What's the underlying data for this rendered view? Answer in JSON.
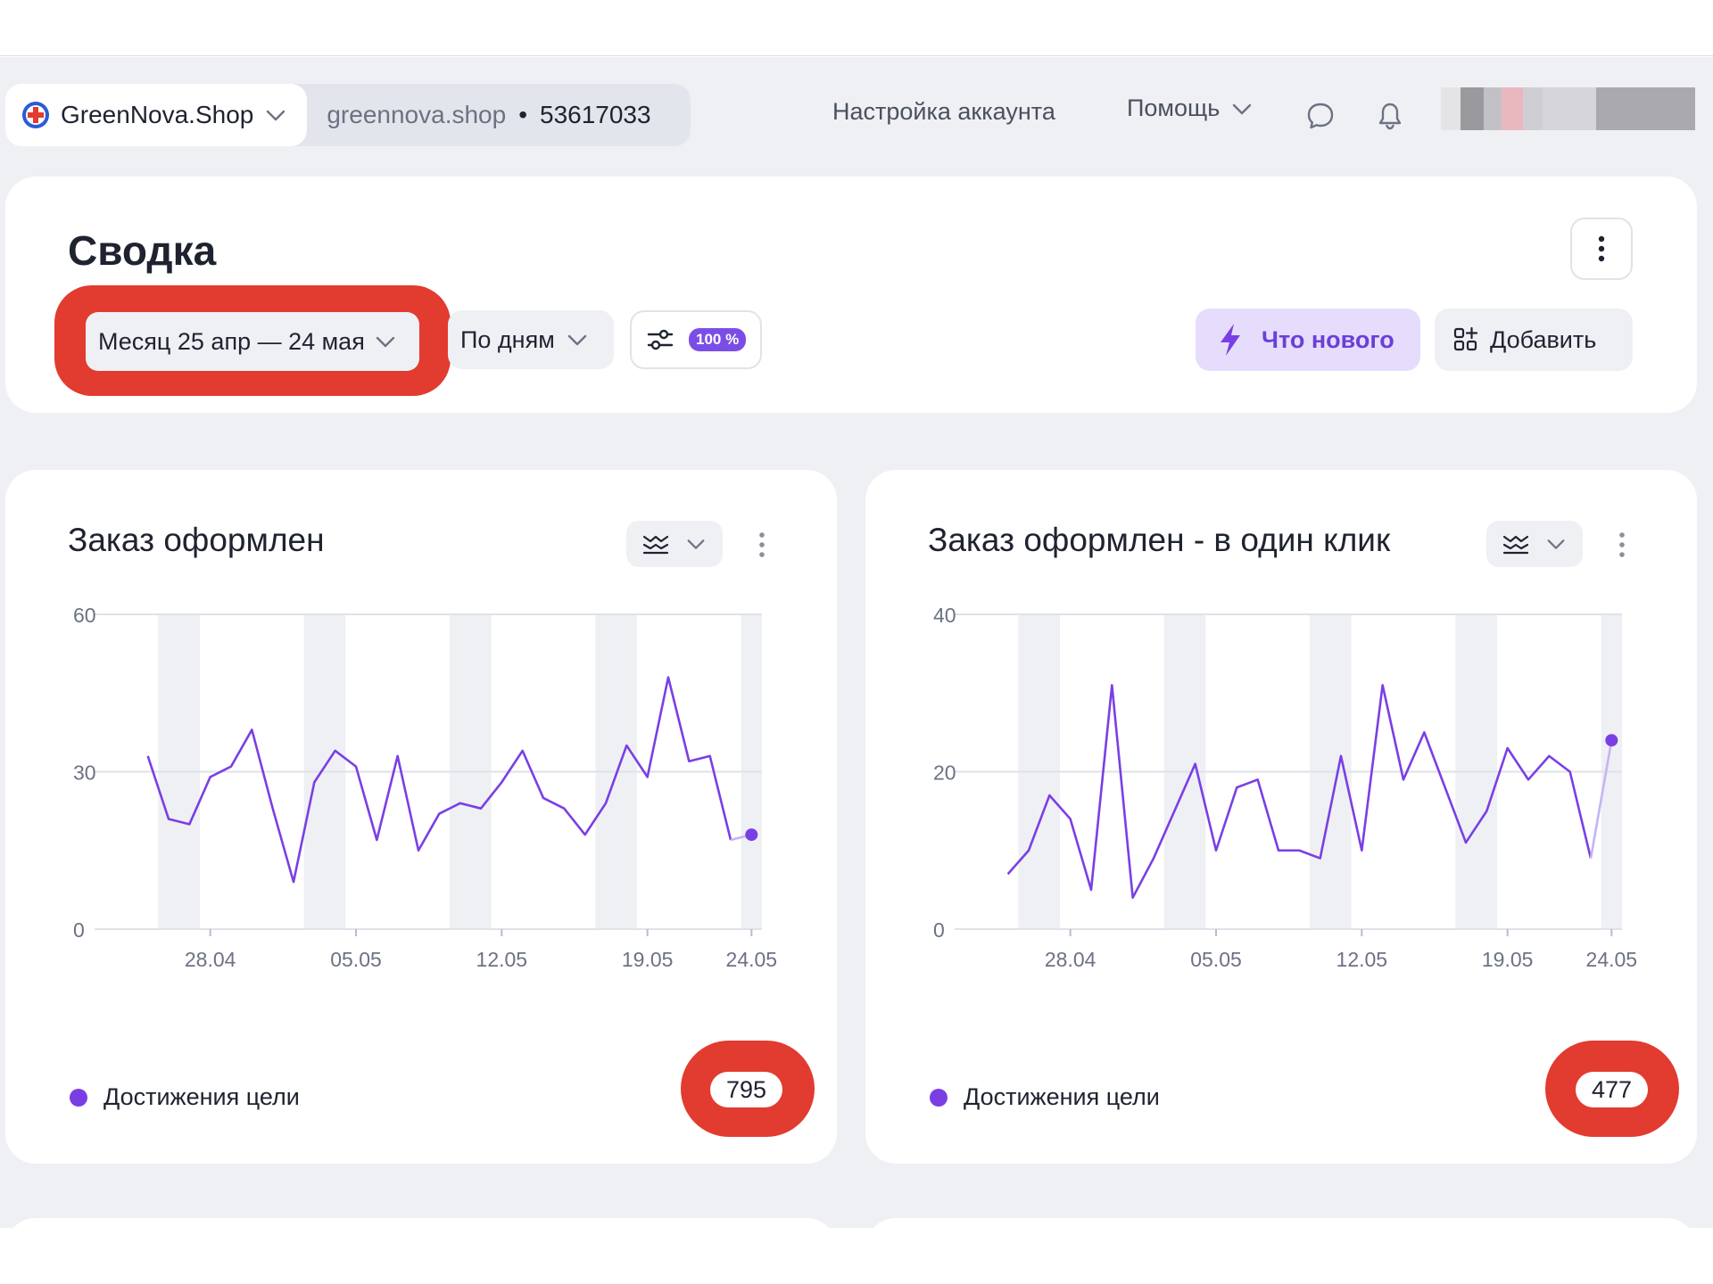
{
  "header": {
    "counter_name": "GreenNova.Shop",
    "counter_domain": "greennova.shop",
    "counter_separator": "•",
    "counter_id": "53617033",
    "account_settings": "Настройка аккаунта",
    "help": "Помощь"
  },
  "summary": {
    "title": "Сводка",
    "period": "Месяц 25 апр — 24 мая",
    "grouping": "По дням",
    "sample_badge": "100 %",
    "whats_new": "Что нового",
    "add": "Добавить"
  },
  "colors": {
    "accent": "#7a3fe4",
    "highlight": "#e23b2f",
    "workspace": "#eef0f4"
  },
  "widgets": [
    {
      "title": "Заказ оформлен",
      "legend": "Достижения цели",
      "total": "795",
      "chart_data": {
        "type": "line",
        "x_ticks": [
          "28.04",
          "05.05",
          "12.05",
          "19.05",
          "24.05"
        ],
        "y_ticks": [
          "60",
          "30",
          "0"
        ],
        "ylim": [
          0,
          60
        ],
        "x": [
          "25.04",
          "26.04",
          "27.04",
          "28.04",
          "29.04",
          "30.04",
          "01.05",
          "02.05",
          "03.05",
          "04.05",
          "05.05",
          "06.05",
          "07.05",
          "08.05",
          "09.05",
          "10.05",
          "11.05",
          "12.05",
          "13.05",
          "14.05",
          "15.05",
          "16.05",
          "17.05",
          "18.05",
          "19.05",
          "20.05",
          "21.05",
          "22.05",
          "23.05",
          "24.05"
        ],
        "values": [
          33,
          21,
          20,
          29,
          31,
          38,
          23,
          9,
          28,
          34,
          31,
          17,
          33,
          15,
          22,
          24,
          23,
          28,
          34,
          25,
          23,
          18,
          24,
          35,
          29,
          48,
          32,
          33,
          17,
          18
        ],
        "last_point_partial": true,
        "grid": true
      }
    },
    {
      "title": "Заказ оформлен - в один клик",
      "legend": "Достижения цели",
      "total": "477",
      "chart_data": {
        "type": "line",
        "x_ticks": [
          "28.04",
          "05.05",
          "12.05",
          "19.05",
          "24.05"
        ],
        "y_ticks": [
          "40",
          "20",
          "0"
        ],
        "ylim": [
          0,
          40
        ],
        "x": [
          "25.04",
          "26.04",
          "27.04",
          "28.04",
          "29.04",
          "30.04",
          "01.05",
          "02.05",
          "03.05",
          "04.05",
          "05.05",
          "06.05",
          "07.05",
          "08.05",
          "09.05",
          "10.05",
          "11.05",
          "12.05",
          "13.05",
          "14.05",
          "15.05",
          "16.05",
          "17.05",
          "18.05",
          "19.05",
          "20.05",
          "21.05",
          "22.05",
          "23.05",
          "24.05"
        ],
        "values": [
          7,
          10,
          17,
          14,
          5,
          31,
          4,
          9,
          15,
          21,
          10,
          18,
          19,
          10,
          10,
          9,
          22,
          10,
          31,
          19,
          25,
          18,
          11,
          15,
          23,
          19,
          22,
          20,
          9,
          24
        ],
        "last_point_partial": true,
        "grid": true
      }
    }
  ]
}
